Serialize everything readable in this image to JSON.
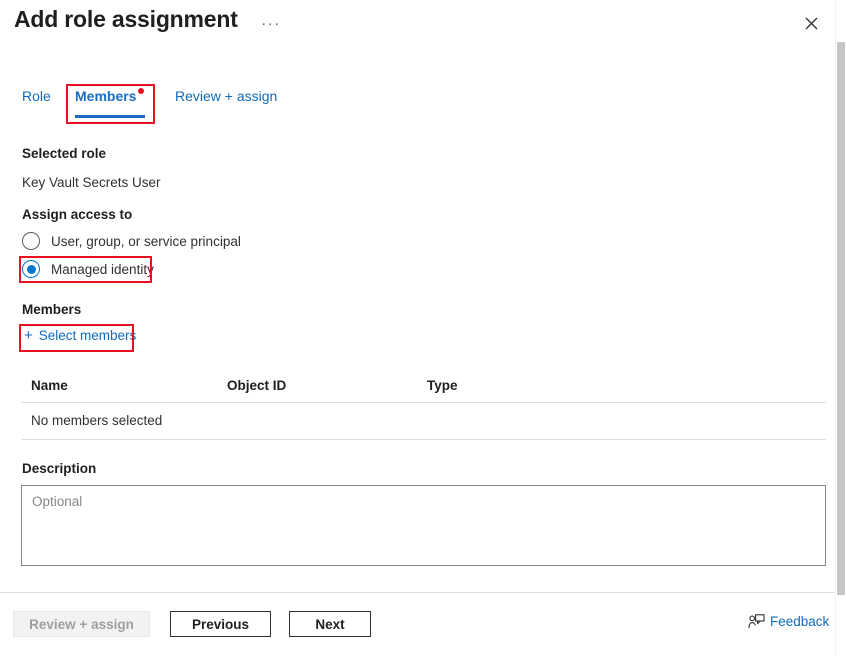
{
  "header": {
    "title": "Add role assignment",
    "ellipsis_label": "···",
    "close_icon": "close-icon"
  },
  "tabs": [
    {
      "label": "Role",
      "selected": false
    },
    {
      "label": "Members",
      "selected": true,
      "has_alert_dot": true
    },
    {
      "label": "Review + assign",
      "selected": false
    }
  ],
  "main": {
    "selected_role_label": "Selected role",
    "selected_role_value": "Key Vault Secrets User",
    "assign_access_label": "Assign access to",
    "radios": [
      {
        "label": "User, group, or service principal",
        "checked": false
      },
      {
        "label": "Managed identity",
        "checked": true
      }
    ],
    "members_label": "Members",
    "select_members_link": "Select members",
    "plus_icon": "plus-icon",
    "table": {
      "columns": [
        "Name",
        "Object ID",
        "Type"
      ],
      "rows": [
        [
          "No members selected",
          "",
          ""
        ]
      ],
      "empty_text": "No members selected"
    },
    "description_label": "Description",
    "description_placeholder": "Optional",
    "description_value": ""
  },
  "footer": {
    "review_assign_label": "Review + assign",
    "review_assign_disabled": true,
    "previous_label": "Previous",
    "next_label": "Next",
    "feedback_label": "Feedback",
    "feedback_icon": "feedback-person-icon"
  },
  "annotations": {
    "highlight_color": "#e81123",
    "boxes": [
      "members-tab",
      "managed-identity-radio",
      "select-members-link"
    ]
  },
  "colors": {
    "accent_blue": "#0078d4",
    "link_blue": "#0f6cbd",
    "text_primary": "#201f1e",
    "text_secondary": "#323130",
    "border": "#e1dfdd",
    "highlight_red": "#e81123"
  }
}
